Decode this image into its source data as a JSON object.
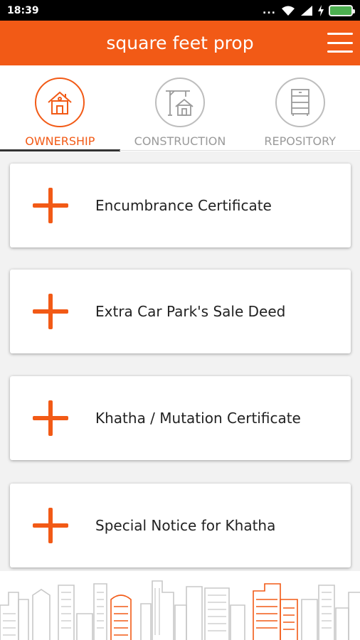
{
  "status_bar": {
    "time": "18:39",
    "dots": "..."
  },
  "app_bar": {
    "title": "square feet prop"
  },
  "tabs": [
    {
      "label": "OWNERSHIP",
      "icon": "house-icon",
      "active": true
    },
    {
      "label": "CONSTRUCTION",
      "icon": "crane-house-icon",
      "active": false
    },
    {
      "label": "REPOSITORY",
      "icon": "cabinet-icon",
      "active": false
    }
  ],
  "documents": [
    {
      "label": "Encumbrance Certificate",
      "icon": "plus-icon"
    },
    {
      "label": "Extra Car Park's Sale Deed",
      "icon": "plus-icon"
    },
    {
      "label": "Khatha / Mutation Certificate",
      "icon": "plus-icon"
    },
    {
      "label": "Special Notice for Khatha",
      "icon": "plus-icon"
    }
  ],
  "colors": {
    "accent": "#f25a16",
    "inactive": "#9a9a9a",
    "skyline_gray": "#c8c8c8"
  }
}
